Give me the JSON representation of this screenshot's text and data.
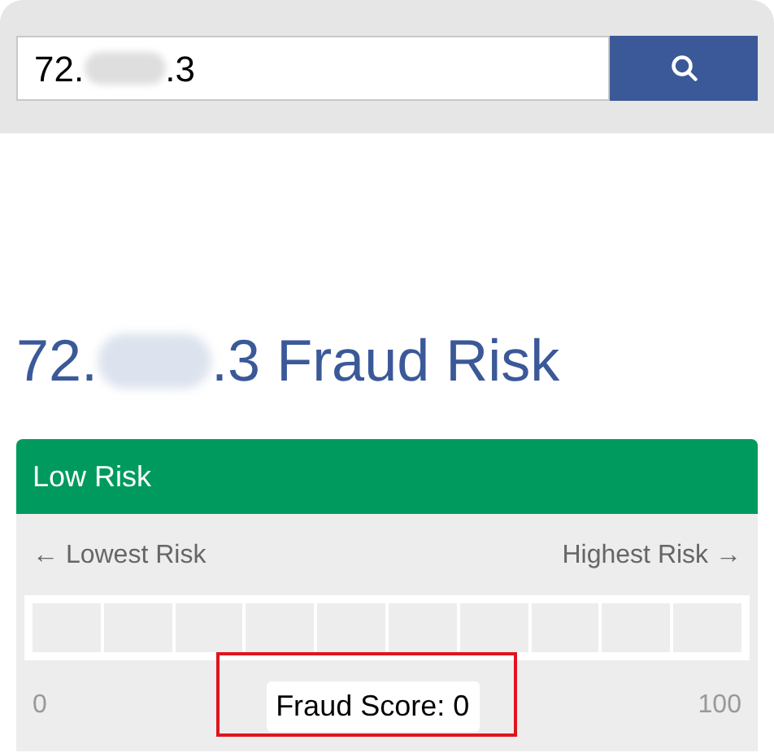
{
  "search": {
    "value_parts": [
      "72.",
      ".3"
    ]
  },
  "heading": {
    "parts": [
      "72.",
      ".3 Fraud Risk"
    ]
  },
  "risk_card": {
    "title": "Low Risk",
    "scale_low": "← Lowest Risk",
    "scale_high": "Highest Risk →",
    "meter": {
      "level": 0
    },
    "min_label": "0",
    "max_label": "100",
    "score": "Fraud Score: 0",
    "highlighted": true
  }
}
